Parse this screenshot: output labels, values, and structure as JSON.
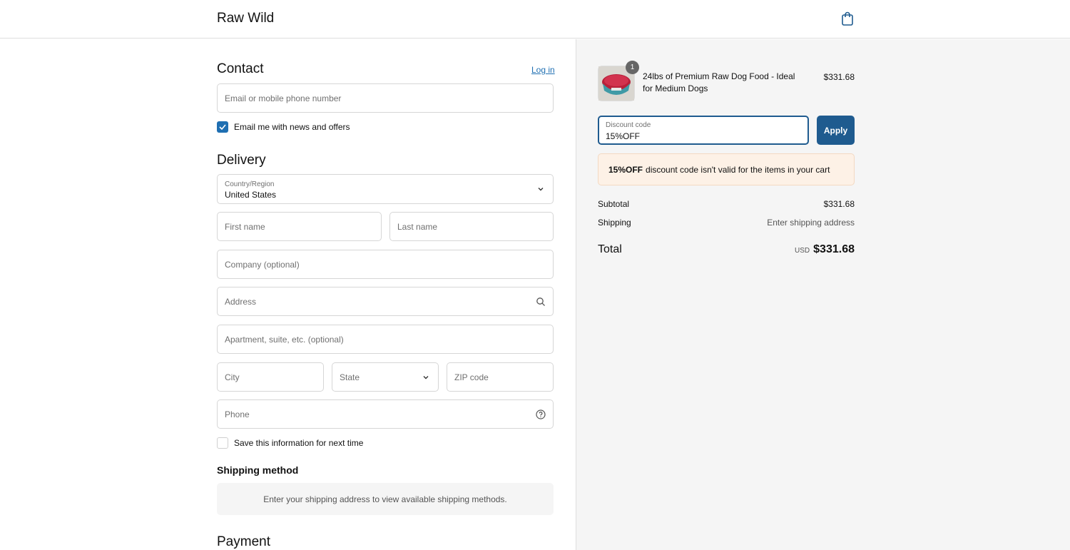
{
  "header": {
    "brand": "Raw Wild",
    "cart_icon": "shopping-bag-icon"
  },
  "contact": {
    "title": "Contact",
    "login_link": "Log in",
    "email_placeholder": "Email or mobile phone number",
    "news_label": "Email me with news and offers",
    "news_checked": true
  },
  "delivery": {
    "title": "Delivery",
    "country_label": "Country/Region",
    "country_value": "United States",
    "first_name": "First name",
    "last_name": "Last name",
    "company": "Company (optional)",
    "address": "Address",
    "apartment": "Apartment, suite, etc. (optional)",
    "city": "City",
    "state": "State",
    "zip": "ZIP code",
    "phone": "Phone",
    "save_label": "Save this information for next time",
    "save_checked": false
  },
  "shipping": {
    "title": "Shipping method",
    "message": "Enter your shipping address to view available shipping methods."
  },
  "payment": {
    "title": "Payment"
  },
  "summary": {
    "product": {
      "qty": "1",
      "name": "24lbs of Premium Raw Dog Food - Ideal for Medium Dogs",
      "price": "$331.68"
    },
    "discount": {
      "label": "Discount code",
      "value": "15%OFF",
      "apply": "Apply"
    },
    "error": {
      "code": "15%OFF",
      "message": "discount code isn't valid for the items in your cart"
    },
    "subtotal_label": "Subtotal",
    "subtotal_value": "$331.68",
    "shipping_label": "Shipping",
    "shipping_value": "Enter shipping address",
    "total_label": "Total",
    "currency": "USD",
    "total_value": "$331.68"
  },
  "colors": {
    "accent": "#1f5b8f",
    "link": "#1f6fb2",
    "error_bg": "#fdf1e6"
  }
}
